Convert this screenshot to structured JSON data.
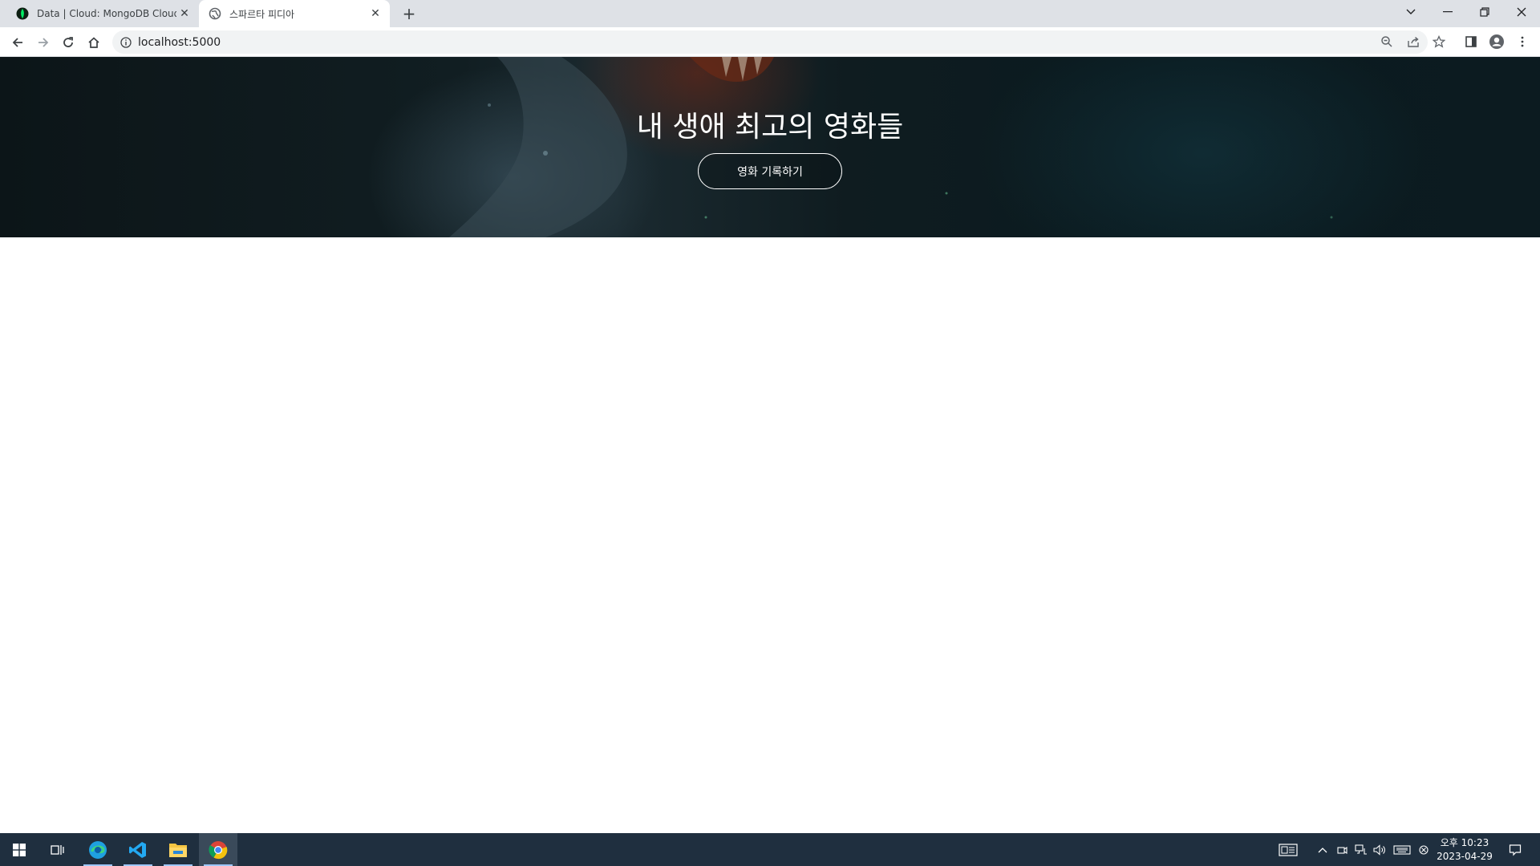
{
  "browser": {
    "tabs": [
      {
        "title": "Data | Cloud: MongoDB Cloud",
        "favicon": "mongodb-leaf-icon"
      },
      {
        "title": "스파르타 피디아",
        "favicon": "globe-icon"
      }
    ],
    "url": "localhost:5000"
  },
  "page": {
    "hero": {
      "title": "내 생애 최고의 영화들",
      "button_label": "영화 기록하기"
    }
  },
  "taskbar": {
    "apps": [
      "windows-start-icon",
      "task-view-icon",
      "edge-icon",
      "vscode-icon",
      "file-explorer-icon",
      "chrome-icon"
    ],
    "clock": {
      "time": "오후 10:23",
      "date": "2023-04-29"
    }
  },
  "colors": {
    "tabbar_bg": "#dee1e6",
    "taskbar_bg": "#1f2f3f",
    "hero_bg": "#0f1c20"
  }
}
